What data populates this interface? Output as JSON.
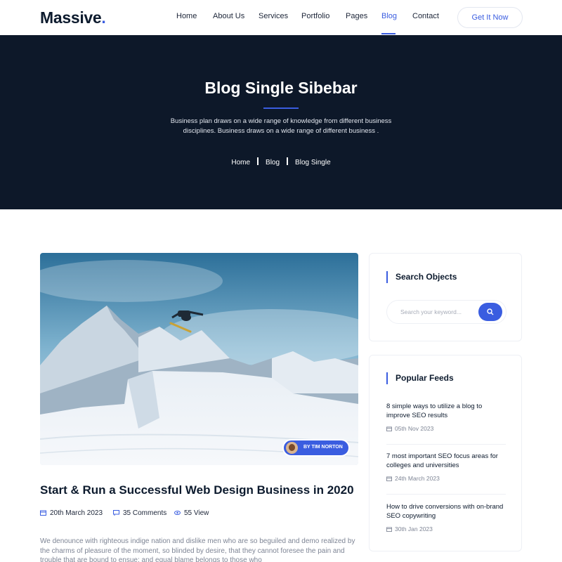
{
  "brand": {
    "name": "Massive",
    "dot": ".",
    "accent_color": "#3a5de0",
    "dark_color": "#0d1829"
  },
  "nav": {
    "items": [
      {
        "label": "Home",
        "active": false
      },
      {
        "label": "About Us",
        "active": false
      },
      {
        "label": "Services",
        "active": false
      },
      {
        "label": "Portfolio",
        "active": false
      },
      {
        "label": "Pages",
        "active": false
      },
      {
        "label": "Blog",
        "active": true
      },
      {
        "label": "Contact",
        "active": false
      }
    ],
    "cta_label": "Get It Now"
  },
  "hero": {
    "title": "Blog Single Sibebar",
    "subtitle_line1": "Business plan draws on a wide range of knowledge from different business",
    "subtitle_line2": "disciplines. Business draws on a wide range of different business .",
    "breadcrumb": [
      "Home",
      "Blog",
      "Blog Single"
    ]
  },
  "post": {
    "author_badge": "BY TIM NORTON",
    "title": "Start & Run a Successful Web Design Business in 2020",
    "date": "20th March 2023",
    "comments": "35 Comments",
    "views": "55 View",
    "body": "We denounce with righteous indige nation and dislike men who are so beguiled and demo realized by the charms of pleasure of the moment, so blinded by desire, that they cannot foresee the pain and trouble that are bound to ensue; and equal blame belongs to those who"
  },
  "sidebar": {
    "search": {
      "title": "Search Objects",
      "placeholder": "Search your keyword..."
    },
    "feeds": {
      "title": "Popular Feeds",
      "items": [
        {
          "title": "8 simple ways to utilize a blog to improve SEO results",
          "date": "05th Nov 2023"
        },
        {
          "title": "7 most important SEO focus areas for colleges and universities",
          "date": "24th March 2023"
        },
        {
          "title": "How to drive conversions with on-brand SEO copywriting",
          "date": "30th Jan 2023"
        }
      ]
    }
  },
  "icons": {
    "calendar": "calendar-icon",
    "comment": "comment-icon",
    "view": "eye-icon",
    "search": "search-icon"
  }
}
